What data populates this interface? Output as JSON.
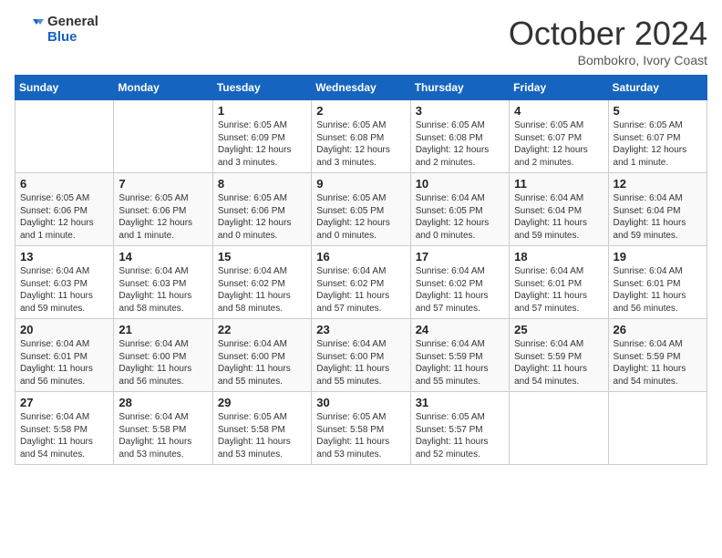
{
  "logo": {
    "line1": "General",
    "line2": "Blue"
  },
  "header": {
    "month": "October 2024",
    "location": "Bombokro, Ivory Coast"
  },
  "weekdays": [
    "Sunday",
    "Monday",
    "Tuesday",
    "Wednesday",
    "Thursday",
    "Friday",
    "Saturday"
  ],
  "weeks": [
    [
      {
        "day": "",
        "info": ""
      },
      {
        "day": "",
        "info": ""
      },
      {
        "day": "1",
        "info": "Sunrise: 6:05 AM\nSunset: 6:09 PM\nDaylight: 12 hours\nand 3 minutes."
      },
      {
        "day": "2",
        "info": "Sunrise: 6:05 AM\nSunset: 6:08 PM\nDaylight: 12 hours\nand 3 minutes."
      },
      {
        "day": "3",
        "info": "Sunrise: 6:05 AM\nSunset: 6:08 PM\nDaylight: 12 hours\nand 2 minutes."
      },
      {
        "day": "4",
        "info": "Sunrise: 6:05 AM\nSunset: 6:07 PM\nDaylight: 12 hours\nand 2 minutes."
      },
      {
        "day": "5",
        "info": "Sunrise: 6:05 AM\nSunset: 6:07 PM\nDaylight: 12 hours\nand 1 minute."
      }
    ],
    [
      {
        "day": "6",
        "info": "Sunrise: 6:05 AM\nSunset: 6:06 PM\nDaylight: 12 hours\nand 1 minute."
      },
      {
        "day": "7",
        "info": "Sunrise: 6:05 AM\nSunset: 6:06 PM\nDaylight: 12 hours\nand 1 minute."
      },
      {
        "day": "8",
        "info": "Sunrise: 6:05 AM\nSunset: 6:06 PM\nDaylight: 12 hours\nand 0 minutes."
      },
      {
        "day": "9",
        "info": "Sunrise: 6:05 AM\nSunset: 6:05 PM\nDaylight: 12 hours\nand 0 minutes."
      },
      {
        "day": "10",
        "info": "Sunrise: 6:04 AM\nSunset: 6:05 PM\nDaylight: 12 hours\nand 0 minutes."
      },
      {
        "day": "11",
        "info": "Sunrise: 6:04 AM\nSunset: 6:04 PM\nDaylight: 11 hours\nand 59 minutes."
      },
      {
        "day": "12",
        "info": "Sunrise: 6:04 AM\nSunset: 6:04 PM\nDaylight: 11 hours\nand 59 minutes."
      }
    ],
    [
      {
        "day": "13",
        "info": "Sunrise: 6:04 AM\nSunset: 6:03 PM\nDaylight: 11 hours\nand 59 minutes."
      },
      {
        "day": "14",
        "info": "Sunrise: 6:04 AM\nSunset: 6:03 PM\nDaylight: 11 hours\nand 58 minutes."
      },
      {
        "day": "15",
        "info": "Sunrise: 6:04 AM\nSunset: 6:02 PM\nDaylight: 11 hours\nand 58 minutes."
      },
      {
        "day": "16",
        "info": "Sunrise: 6:04 AM\nSunset: 6:02 PM\nDaylight: 11 hours\nand 57 minutes."
      },
      {
        "day": "17",
        "info": "Sunrise: 6:04 AM\nSunset: 6:02 PM\nDaylight: 11 hours\nand 57 minutes."
      },
      {
        "day": "18",
        "info": "Sunrise: 6:04 AM\nSunset: 6:01 PM\nDaylight: 11 hours\nand 57 minutes."
      },
      {
        "day": "19",
        "info": "Sunrise: 6:04 AM\nSunset: 6:01 PM\nDaylight: 11 hours\nand 56 minutes."
      }
    ],
    [
      {
        "day": "20",
        "info": "Sunrise: 6:04 AM\nSunset: 6:01 PM\nDaylight: 11 hours\nand 56 minutes."
      },
      {
        "day": "21",
        "info": "Sunrise: 6:04 AM\nSunset: 6:00 PM\nDaylight: 11 hours\nand 56 minutes."
      },
      {
        "day": "22",
        "info": "Sunrise: 6:04 AM\nSunset: 6:00 PM\nDaylight: 11 hours\nand 55 minutes."
      },
      {
        "day": "23",
        "info": "Sunrise: 6:04 AM\nSunset: 6:00 PM\nDaylight: 11 hours\nand 55 minutes."
      },
      {
        "day": "24",
        "info": "Sunrise: 6:04 AM\nSunset: 5:59 PM\nDaylight: 11 hours\nand 55 minutes."
      },
      {
        "day": "25",
        "info": "Sunrise: 6:04 AM\nSunset: 5:59 PM\nDaylight: 11 hours\nand 54 minutes."
      },
      {
        "day": "26",
        "info": "Sunrise: 6:04 AM\nSunset: 5:59 PM\nDaylight: 11 hours\nand 54 minutes."
      }
    ],
    [
      {
        "day": "27",
        "info": "Sunrise: 6:04 AM\nSunset: 5:58 PM\nDaylight: 11 hours\nand 54 minutes."
      },
      {
        "day": "28",
        "info": "Sunrise: 6:04 AM\nSunset: 5:58 PM\nDaylight: 11 hours\nand 53 minutes."
      },
      {
        "day": "29",
        "info": "Sunrise: 6:05 AM\nSunset: 5:58 PM\nDaylight: 11 hours\nand 53 minutes."
      },
      {
        "day": "30",
        "info": "Sunrise: 6:05 AM\nSunset: 5:58 PM\nDaylight: 11 hours\nand 53 minutes."
      },
      {
        "day": "31",
        "info": "Sunrise: 6:05 AM\nSunset: 5:57 PM\nDaylight: 11 hours\nand 52 minutes."
      },
      {
        "day": "",
        "info": ""
      },
      {
        "day": "",
        "info": ""
      }
    ]
  ]
}
